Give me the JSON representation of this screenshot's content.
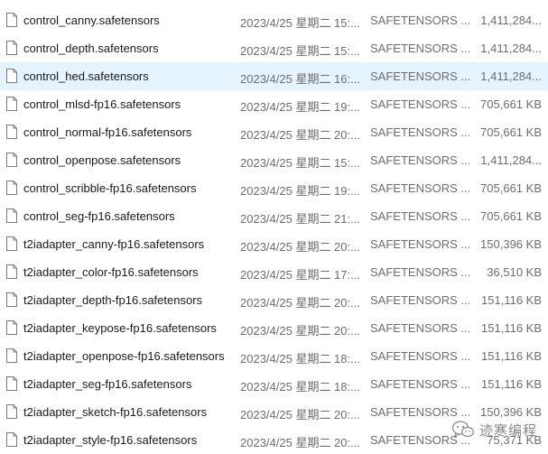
{
  "files": [
    {
      "name": "control_canny.safetensors",
      "modified": "2023/4/25 星期二 15:...",
      "type": "SAFETENSORS ...",
      "size": "1,411,284..."
    },
    {
      "name": "control_depth.safetensors",
      "modified": "2023/4/25 星期二 15:...",
      "type": "SAFETENSORS ...",
      "size": "1,411,284..."
    },
    {
      "name": "control_hed.safetensors",
      "modified": "2023/4/25 星期二 16:...",
      "type": "SAFETENSORS ...",
      "size": "1,411,284..."
    },
    {
      "name": "control_mlsd-fp16.safetensors",
      "modified": "2023/4/25 星期二 19:...",
      "type": "SAFETENSORS ...",
      "size": "705,661 KB"
    },
    {
      "name": "control_normal-fp16.safetensors",
      "modified": "2023/4/25 星期二 20:...",
      "type": "SAFETENSORS ...",
      "size": "705,661 KB"
    },
    {
      "name": "control_openpose.safetensors",
      "modified": "2023/4/25 星期二 15:...",
      "type": "SAFETENSORS ...",
      "size": "1,411,284..."
    },
    {
      "name": "control_scribble-fp16.safetensors",
      "modified": "2023/4/25 星期二 19:...",
      "type": "SAFETENSORS ...",
      "size": "705,661 KB"
    },
    {
      "name": "control_seg-fp16.safetensors",
      "modified": "2023/4/25 星期二 21:...",
      "type": "SAFETENSORS ...",
      "size": "705,661 KB"
    },
    {
      "name": "t2iadapter_canny-fp16.safetensors",
      "modified": "2023/4/25 星期二 20:...",
      "type": "SAFETENSORS ...",
      "size": "150,396 KB"
    },
    {
      "name": "t2iadapter_color-fp16.safetensors",
      "modified": "2023/4/25 星期二 17:...",
      "type": "SAFETENSORS ...",
      "size": "36,510 KB"
    },
    {
      "name": "t2iadapter_depth-fp16.safetensors",
      "modified": "2023/4/25 星期二 20:...",
      "type": "SAFETENSORS ...",
      "size": "151,116 KB"
    },
    {
      "name": "t2iadapter_keypose-fp16.safetensors",
      "modified": "2023/4/25 星期二 20:...",
      "type": "SAFETENSORS ...",
      "size": "151,116 KB"
    },
    {
      "name": "t2iadapter_openpose-fp16.safetensors",
      "modified": "2023/4/25 星期二 18:...",
      "type": "SAFETENSORS ...",
      "size": "151,116 KB"
    },
    {
      "name": "t2iadapter_seg-fp16.safetensors",
      "modified": "2023/4/25 星期二 18:...",
      "type": "SAFETENSORS ...",
      "size": "151,116 KB"
    },
    {
      "name": "t2iadapter_sketch-fp16.safetensors",
      "modified": "2023/4/25 星期二 20:...",
      "type": "SAFETENSORS ...",
      "size": "150,396 KB"
    },
    {
      "name": "t2iadapter_style-fp16.safetensors",
      "modified": "2023/4/25 星期二 20:...",
      "type": "SAFETENSORS ...",
      "size": "75,371 KB"
    }
  ],
  "selected_index": 2,
  "icon": "file-icon",
  "colors": {
    "selected_row": "#e5f3ff",
    "name_text": "#1a1a1a",
    "meta_text": "#6d6d6d"
  },
  "watermark": {
    "text": "迹寒编程",
    "icon": "wechat-icon"
  }
}
